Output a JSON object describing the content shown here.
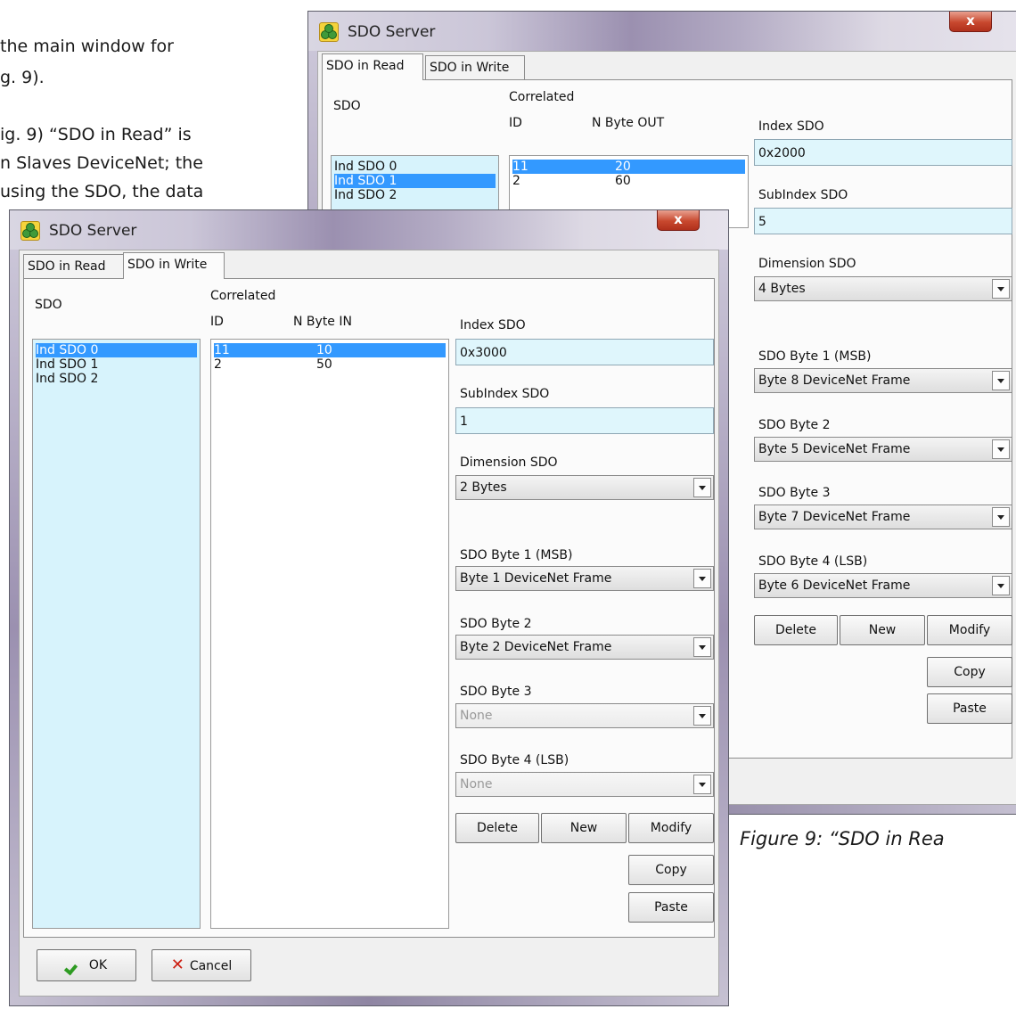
{
  "document": {
    "lines": [
      "the main window for",
      "g. 9).",
      "ig. 9) “SDO in Read” is",
      "n Slaves DeviceNet; the",
      "using the SDO, the data"
    ],
    "caption": "Figure 9: “SDO in Rea"
  },
  "back_window": {
    "title": "SDO Server",
    "close_label": "x",
    "tabs": [
      "SDO in Read",
      "SDO in Write"
    ],
    "active_tab": "SDO in Read",
    "sdo_label": "SDO",
    "sdo_items": [
      "Ind SDO 0",
      "Ind SDO 1",
      "Ind SDO 2"
    ],
    "sdo_selected": "Ind SDO 1",
    "correlated_label": "Correlated",
    "col_id": "ID",
    "col_nbyte": "N Byte OUT",
    "correlated_rows": [
      {
        "id": "11",
        "n": "20"
      },
      {
        "id": "2",
        "n": "60"
      }
    ],
    "index_label": "Index SDO",
    "index_value": "0x2000",
    "subindex_label": "SubIndex SDO",
    "subindex_value": "5",
    "dimension_label": "Dimension SDO",
    "dimension_value": "4 Bytes",
    "byte1_label": "SDO Byte 1 (MSB)",
    "byte1_value": "Byte 8 DeviceNet Frame",
    "byte2_label": "SDO Byte 2",
    "byte2_value": "Byte 5 DeviceNet Frame",
    "byte3_label": "SDO Byte 3",
    "byte3_value": "Byte 7 DeviceNet Frame",
    "byte4_label": "SDO Byte 4 (LSB)",
    "byte4_value": "Byte 6 DeviceNet Frame",
    "delete_label": "Delete",
    "new_label": "New",
    "modify_label": "Modify",
    "copy_label": "Copy",
    "paste_label": "Paste"
  },
  "front_window": {
    "title": "SDO Server",
    "close_label": "x",
    "tabs": [
      "SDO in Read",
      "SDO in Write"
    ],
    "active_tab": "SDO in Write",
    "sdo_label": "SDO",
    "sdo_items": [
      "Ind SDO 0",
      "Ind SDO 1",
      "Ind SDO 2"
    ],
    "sdo_selected": "Ind SDO 0",
    "correlated_label": "Correlated",
    "col_id": "ID",
    "col_nbyte": "N Byte IN",
    "correlated_rows": [
      {
        "id": "11",
        "n": "10"
      },
      {
        "id": "2",
        "n": "50"
      }
    ],
    "index_label": "Index SDO",
    "index_value": "0x3000",
    "subindex_label": "SubIndex SDO",
    "subindex_value": "1",
    "dimension_label": "Dimension SDO",
    "dimension_value": "2 Bytes",
    "byte1_label": "SDO Byte 1 (MSB)",
    "byte1_value": "Byte 1 DeviceNet Frame",
    "byte2_label": "SDO Byte 2",
    "byte2_value": "Byte 2 DeviceNet Frame",
    "byte3_label": "SDO Byte 3",
    "byte3_value": "None",
    "byte4_label": "SDO Byte 4 (LSB)",
    "byte4_value": "None",
    "delete_label": "Delete",
    "new_label": "New",
    "modify_label": "Modify",
    "copy_label": "Copy",
    "paste_label": "Paste",
    "ok_label": "OK",
    "cancel_label": "Cancel"
  },
  "icons": {
    "app": "sdo-server-app-icon",
    "close": "close-icon",
    "dropdown": "chevron-down-icon",
    "ok": "checkmark-icon",
    "cancel": "x-cancel-icon"
  },
  "colors": {
    "selection": "#3399ff",
    "field_bg": "#dff6fc",
    "sdo_list_bg": "#d7f3fc",
    "close_button": "#c8482e",
    "ok_check": "#2e9b22",
    "cancel_x": "#cc1d10"
  }
}
